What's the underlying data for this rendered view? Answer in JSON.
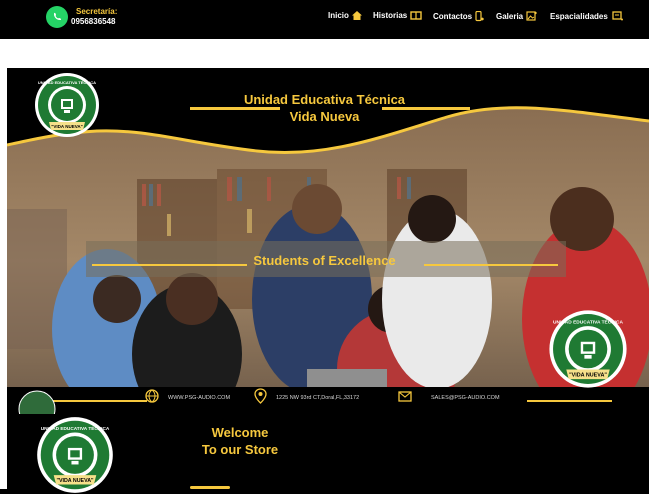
{
  "header": {
    "secretaria_label": "Secretaría:",
    "phone": "0956836548",
    "menu": [
      {
        "label": "Inicio",
        "icon": "home-icon"
      },
      {
        "label": "Historias",
        "icon": "book-icon"
      },
      {
        "label": "Contactos",
        "icon": "phone-icon"
      },
      {
        "label": "Galeria",
        "icon": "image-icon"
      },
      {
        "label": "Espacialidades",
        "icon": "board-icon"
      }
    ]
  },
  "hero": {
    "title_line1": "Unidad Educativa Técnica",
    "title_line2": "Vida Nueva",
    "motto": "Students of Excellence",
    "logo_top_text": "UNIDAD EDUCATIVA TECNICA",
    "logo_bottom_text": "\"VIDA NUEVA\""
  },
  "contact": {
    "website": "WWW.PSG-AUDIO.COM",
    "address": "1225 NW 93rd  CT,Doral,FL,33172",
    "email": "SALES@PSG-AUDIO.COM"
  },
  "store": {
    "welcome": "Welcome",
    "subtitle": "To our Store"
  },
  "colors": {
    "accent": "#f6c83e",
    "background": "#000000",
    "whatsapp": "#25d366"
  }
}
